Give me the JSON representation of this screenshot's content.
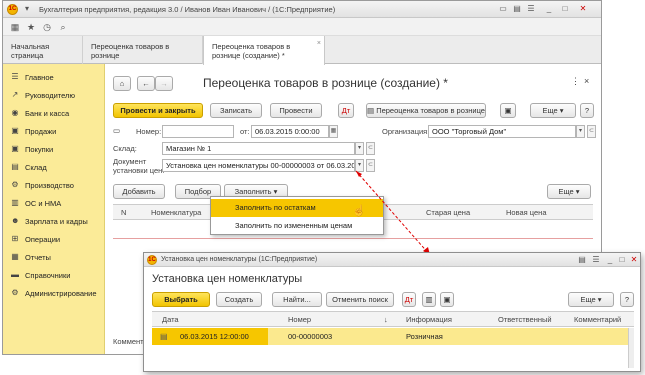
{
  "main_window": {
    "title": "Бухгалтерия предприятия, редакция 3.0 / Иванов Иван Иванович / (1С:Предприятие)",
    "tabs": [
      {
        "label": "Начальная страница"
      },
      {
        "label": "Переоценка товаров в рознице"
      },
      {
        "label": "Переоценка товаров в рознице (создание) *"
      }
    ],
    "sidebar": [
      {
        "label": "Главное",
        "icon": "list-icon"
      },
      {
        "label": "Руководителю",
        "icon": "chart-icon"
      },
      {
        "label": "Банк и касса",
        "icon": "bank-icon"
      },
      {
        "label": "Продажи",
        "icon": "cart-icon"
      },
      {
        "label": "Покупки",
        "icon": "cart-icon"
      },
      {
        "label": "Склад",
        "icon": "warehouse-icon"
      },
      {
        "label": "Производство",
        "icon": "gear-icon"
      },
      {
        "label": "ОС и НМА",
        "icon": "building-icon"
      },
      {
        "label": "Зарплата и кадры",
        "icon": "people-icon"
      },
      {
        "label": "Операции",
        "icon": "ops-icon"
      },
      {
        "label": "Отчеты",
        "icon": "report-icon"
      },
      {
        "label": "Справочники",
        "icon": "book-icon"
      },
      {
        "label": "Администрирование",
        "icon": "gear-icon"
      }
    ],
    "form": {
      "title": "Переоценка товаров в рознице (создание) *",
      "buttons": {
        "post_close": "Провести и закрыть",
        "save": "Записать",
        "post": "Провести",
        "report": "Переоценка товаров в рознице",
        "more": "Еще",
        "help": "?"
      },
      "number_label": "Номер:",
      "number_value": "",
      "date_label": "от:",
      "date_value": "06.03.2015  0:00:00",
      "org_label": "Организация:",
      "org_value": "ООО \"Торговый Дом\"",
      "warehouse_label": "Склад:",
      "warehouse_value": "Магазин № 1",
      "doc_label_1": "Документ",
      "doc_label_2": "установки цен:",
      "doc_value": "Установка цен номенклатуры 00-00000003 от 06.03.2015 12:00",
      "grid_buttons": {
        "add": "Добавить",
        "pick": "Подбор",
        "fill": "Заполнить",
        "more": "Еще"
      },
      "columns": [
        "N",
        "Номенклатура",
        "Старая цена",
        "Новая цена"
      ],
      "comment_label": "Комментарий:",
      "fill_menu": [
        "Заполнить по остаткам",
        "Заполнить по измененным ценам"
      ]
    }
  },
  "second_window": {
    "title": "Установка цен номенклатуры  (1С:Предприятие)",
    "heading": "Установка цен номенклатуры",
    "buttons": {
      "select": "Выбрать",
      "create": "Создать",
      "find": "Найти...",
      "cancel_search": "Отменить поиск",
      "more": "Еще",
      "help": "?"
    },
    "columns": [
      "Дата",
      "Номер",
      "Информация",
      "Ответственный",
      "Комментарий"
    ],
    "rows": [
      {
        "date": "06.03.2015 12:00:00",
        "number": "00-00000003",
        "info": "Розничная",
        "responsible": "",
        "comment": ""
      }
    ]
  },
  "colors": {
    "accent": "#f6c600",
    "sidebar": "#fbeb98",
    "arrow": "#e00000"
  }
}
